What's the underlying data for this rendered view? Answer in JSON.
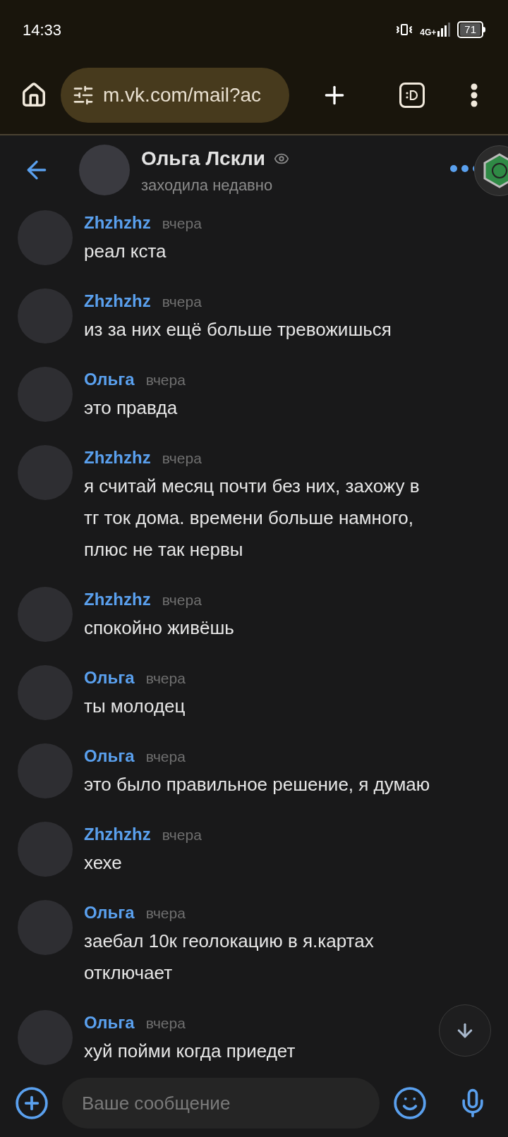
{
  "status_bar": {
    "time": "14:33",
    "network": "4G+",
    "battery": "71"
  },
  "browser": {
    "url": "m.vk.com/mail?ac"
  },
  "chat_header": {
    "name": "Ольга Лскли",
    "status": "заходила недавно"
  },
  "messages": [
    {
      "author": "Zhzhzhz",
      "time": "вчера",
      "lines": [
        "реал кста"
      ]
    },
    {
      "author": "Zhzhzhz",
      "time": "вчера",
      "lines": [
        "из за них ещё больше тревожишься"
      ]
    },
    {
      "author": "Ольга",
      "time": "вчера",
      "lines": [
        "это правда"
      ]
    },
    {
      "author": "Zhzhzhz",
      "time": "вчера",
      "lines": [
        "я считай месяц почти без них, захожу в",
        "тг ток дома. времени больше намного,",
        "плюс не так нервы"
      ]
    },
    {
      "author": "Zhzhzhz",
      "time": "вчера",
      "lines": [
        "спокойно живёшь"
      ]
    },
    {
      "author": "Ольга",
      "time": "вчера",
      "lines": [
        "ты молодец"
      ]
    },
    {
      "author": "Ольга",
      "time": "вчера",
      "lines": [
        "это было правильное решение, я думаю"
      ]
    },
    {
      "author": "Zhzhzhz",
      "time": "вчера",
      "lines": [
        "хехе"
      ]
    },
    {
      "author": "Ольга",
      "time": "вчера",
      "lines": [
        "заебал 10к геолокацию в я.картах",
        "отключает"
      ]
    },
    {
      "author": "Ольга",
      "time": "вчера",
      "lines": [
        "хуй пойми когда приедет"
      ]
    }
  ],
  "composer": {
    "placeholder": "Ваше сообщение"
  }
}
